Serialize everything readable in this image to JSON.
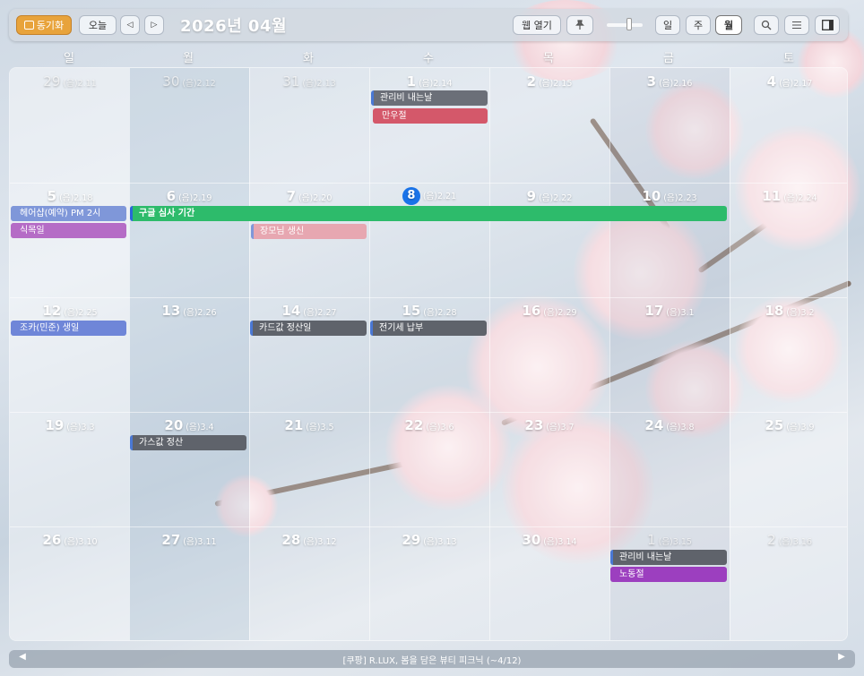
{
  "toolbar": {
    "sync_label": "동기화",
    "today_label": "오늘",
    "prev_glyph": "◁",
    "next_glyph": "▷",
    "month_title": "2026년 04월",
    "webopen_label": "웹 열기",
    "pin_icon": "pin-icon",
    "view_day": "일",
    "view_week": "주",
    "view_month": "월",
    "search_icon": "search-icon",
    "list_icon": "list-icon",
    "panel_icon": "panel-icon",
    "active_view": "월",
    "accent": "#e8a33b"
  },
  "weekdays": [
    "일",
    "월",
    "화",
    "수",
    "목",
    "금",
    "토"
  ],
  "days": [
    {
      "d": "29",
      "l": "(음)2.11",
      "muted": true
    },
    {
      "d": "30",
      "l": "(음)2.12",
      "muted": true
    },
    {
      "d": "31",
      "l": "(음)2.13",
      "muted": true
    },
    {
      "d": "1",
      "l": "(음)2.14"
    },
    {
      "d": "2",
      "l": "(음)2.15"
    },
    {
      "d": "3",
      "l": "(음)2.16"
    },
    {
      "d": "4",
      "l": "(음)2.17"
    },
    {
      "d": "5",
      "l": "(음)2.18"
    },
    {
      "d": "6",
      "l": "(음)2.19"
    },
    {
      "d": "7",
      "l": "(음)2.20"
    },
    {
      "d": "8",
      "l": "(음)2.21",
      "today": true
    },
    {
      "d": "9",
      "l": "(음)2.22"
    },
    {
      "d": "10",
      "l": "(음)2.23"
    },
    {
      "d": "11",
      "l": "(음)2.24"
    },
    {
      "d": "12",
      "l": "(음)2.25"
    },
    {
      "d": "13",
      "l": "(음)2.26"
    },
    {
      "d": "14",
      "l": "(음)2.27"
    },
    {
      "d": "15",
      "l": "(음)2.28"
    },
    {
      "d": "16",
      "l": "(음)2.29"
    },
    {
      "d": "17",
      "l": "(음)3.1"
    },
    {
      "d": "18",
      "l": "(음)3.2"
    },
    {
      "d": "19",
      "l": "(음)3.3"
    },
    {
      "d": "20",
      "l": "(음)3.4"
    },
    {
      "d": "21",
      "l": "(음)3.5"
    },
    {
      "d": "22",
      "l": "(음)3.6"
    },
    {
      "d": "23",
      "l": "(음)3.7"
    },
    {
      "d": "24",
      "l": "(음)3.8"
    },
    {
      "d": "25",
      "l": "(음)3.9"
    },
    {
      "d": "26",
      "l": "(음)3.10"
    },
    {
      "d": "27",
      "l": "(음)3.11"
    },
    {
      "d": "28",
      "l": "(음)3.12"
    },
    {
      "d": "29",
      "l": "(음)3.13"
    },
    {
      "d": "30",
      "l": "(음)3.14"
    },
    {
      "d": "1",
      "l": "(음)3.15",
      "muted": true
    },
    {
      "d": "2",
      "l": "(음)3.16",
      "muted": true
    }
  ],
  "events": [
    {
      "title": "관리비 내는날",
      "color": "#6b6f78",
      "bar": "#4a78d4"
    },
    {
      "title": "만우절",
      "color": "#d4586a"
    },
    {
      "title": "헤어샵(예약) PM 2시",
      "color": "#7f97d9"
    },
    {
      "title": "식목일",
      "color": "#b56cc6"
    },
    {
      "title": "구글 심사 기간",
      "color": "#2dbb6b",
      "bar": "#2a66d8"
    },
    {
      "title": "장모님 생신",
      "color": "#e7a7b1",
      "bar": "#7f97d9"
    },
    {
      "title": "조카(민준) 생일",
      "color": "#6f86d8"
    },
    {
      "title": "카드값 정산일",
      "color": "#5f636b",
      "bar": "#4a78d4"
    },
    {
      "title": "전기세 납부",
      "color": "#5f636b",
      "bar": "#4a78d4"
    },
    {
      "title": "가스값 정산",
      "color": "#5f636b",
      "bar": "#4a78d4"
    },
    {
      "title": "관리비 내는날",
      "color": "#5f636b",
      "bar": "#4a78d4"
    },
    {
      "title": "노동절",
      "color": "#9c3fbf"
    }
  ],
  "bottom_bar": {
    "prev_glyph": "◀",
    "next_glyph": "▶",
    "text": "[쿠팡] R.LUX, 봄을 담은 뷰티 피크닉 (~4/12)"
  }
}
